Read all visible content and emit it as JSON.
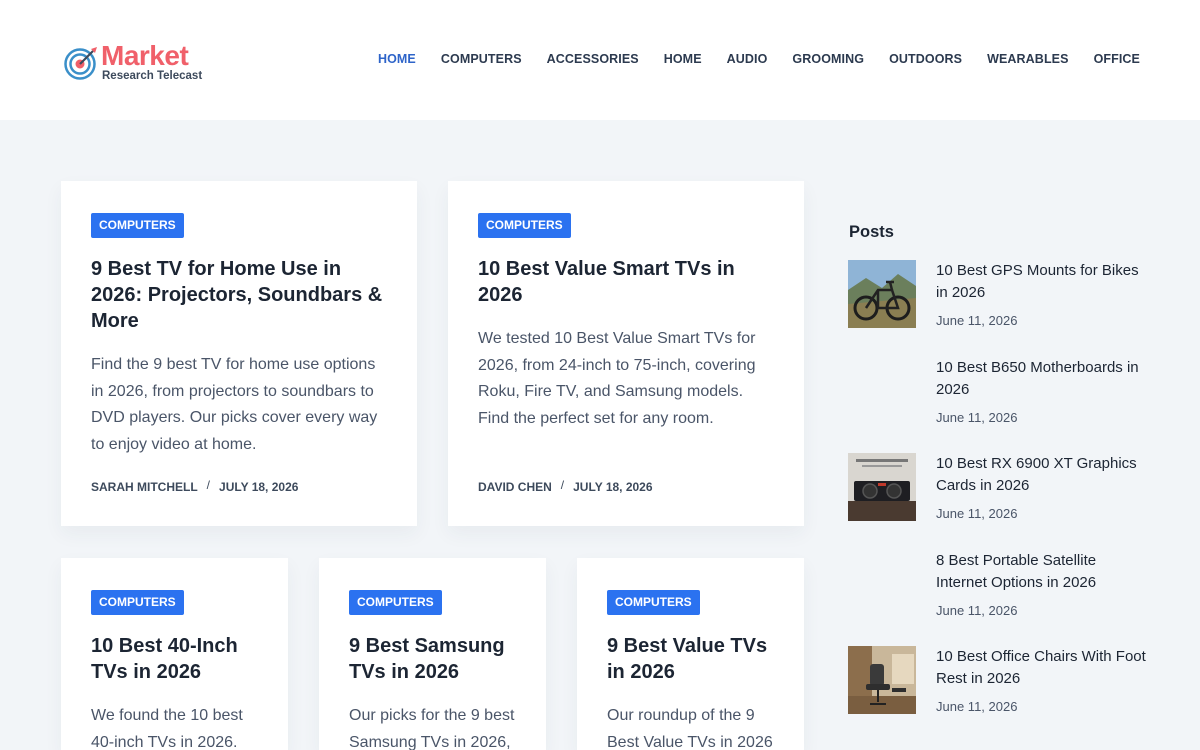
{
  "brand": {
    "name_top": "Market",
    "name_bottom": "Research Telecast",
    "colors": {
      "accent": "#f0606a",
      "nav_active": "#2e64c9",
      "badge": "#2b72f0"
    }
  },
  "nav": [
    {
      "label": "HOME",
      "active": true
    },
    {
      "label": "COMPUTERS",
      "active": false
    },
    {
      "label": "ACCESSORIES",
      "active": false
    },
    {
      "label": "HOME",
      "active": false
    },
    {
      "label": "AUDIO",
      "active": false
    },
    {
      "label": "GROOMING",
      "active": false
    },
    {
      "label": "OUTDOORS",
      "active": false
    },
    {
      "label": "WEARABLES",
      "active": false
    },
    {
      "label": "OFFICE",
      "active": false
    }
  ],
  "articles": [
    {
      "category": "COMPUTERS",
      "title": "9 Best TV for Home Use in 2026: Projectors, Soundbars & More",
      "excerpt": "Find the 9 best TV for home use options in 2026, from projectors to soundbars to DVD players. Our picks cover every way to enjoy video at home.",
      "author": "SARAH MITCHELL",
      "date": "JULY 18, 2026"
    },
    {
      "category": "COMPUTERS",
      "title": "10 Best Value Smart TVs in 2026",
      "excerpt": "We tested 10 Best Value Smart TVs for 2026, from 24-inch to 75-inch, covering Roku, Fire TV, and Samsung models. Find the perfect set for any room.",
      "author": "DAVID CHEN",
      "date": "JULY 18, 2026"
    },
    {
      "category": "COMPUTERS",
      "title": "10 Best 40-Inch TVs in 2026",
      "excerpt": "We found the 10 best 40-inch TVs in 2026."
    },
    {
      "category": "COMPUTERS",
      "title": "9 Best Samsung TVs in 2026",
      "excerpt": "Our picks for the 9 best Samsung TVs in 2026,"
    },
    {
      "category": "COMPUTERS",
      "title": "9 Best Value TVs in 2026",
      "excerpt": "Our roundup of the 9 Best Value TVs in 2026"
    }
  ],
  "sidebar": {
    "title": "Posts",
    "posts": [
      {
        "title": "10 Best GPS Mounts for Bikes in 2026",
        "date": "June 11, 2026",
        "thumb": "bike-photo"
      },
      {
        "title": "10 Best B650 Motherboards in 2026",
        "date": "June 11, 2026",
        "thumb": "none"
      },
      {
        "title": "10 Best RX 6900 XT Graphics Cards in 2026",
        "date": "June 11, 2026",
        "thumb": "graphics-card-photo"
      },
      {
        "title": "8 Best Portable Satellite Internet Options in 2026",
        "date": "June 11, 2026",
        "thumb": "none"
      },
      {
        "title": "10 Best Office Chairs With Foot Rest in 2026",
        "date": "June 11, 2026",
        "thumb": "office-chair-photo"
      }
    ]
  }
}
